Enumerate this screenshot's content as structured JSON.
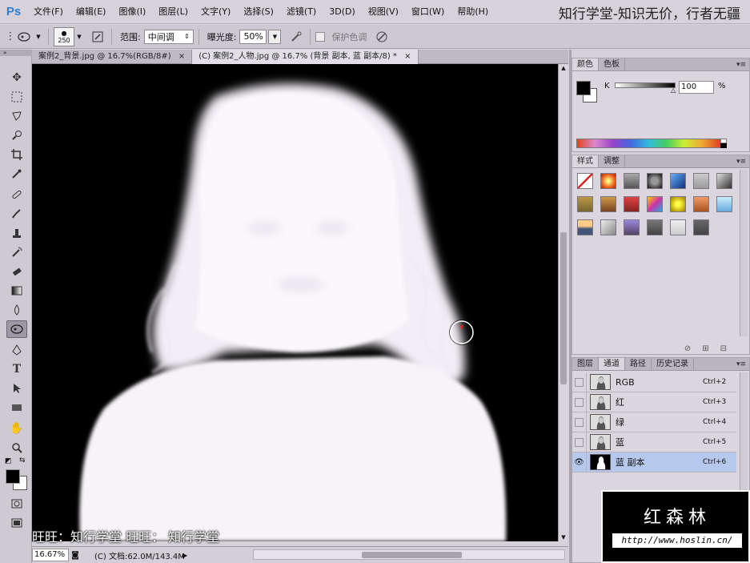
{
  "app": {
    "logo": "Ps"
  },
  "menu": [
    "文件(F)",
    "编辑(E)",
    "图像(I)",
    "图层(L)",
    "文字(Y)",
    "选择(S)",
    "滤镜(T)",
    "3D(D)",
    "视图(V)",
    "窗口(W)",
    "帮助(H)"
  ],
  "watermark_top": "知行学堂-知识无价，行者无疆",
  "options": {
    "brush_size": "250",
    "range_label": "范围:",
    "range_value": "中间调",
    "exposure_label": "曝光度:",
    "exposure_value": "50%",
    "protect_label": "保护色调"
  },
  "tabs": [
    {
      "label": "案例2_背景.jpg @ 16.7%(RGB/8#)",
      "close": "×"
    },
    {
      "label": "(C) 案例2_人物.jpg @ 16.7% (背景 副本, 蓝 副本/8) *",
      "close": "×"
    }
  ],
  "status": {
    "zoom": "16.67%",
    "doc": "(C) 文档:62.0M/143.4M"
  },
  "caption": "旺旺：知行学堂  旺旺：  知行学堂",
  "color_panel": {
    "tabs": [
      "颜色",
      "色板"
    ],
    "channel_label": "K",
    "value": "100",
    "unit": "%",
    "fg": "#000000",
    "bg": "#ffffff"
  },
  "styles_panel": {
    "tabs": [
      "样式",
      "调整"
    ]
  },
  "layers_panel": {
    "tabs": [
      "图层",
      "通道",
      "路径",
      "历史记录"
    ],
    "channels": [
      {
        "name": "RGB",
        "shortcut": "Ctrl+2",
        "visible": false
      },
      {
        "name": "红",
        "shortcut": "Ctrl+3",
        "visible": false
      },
      {
        "name": "绿",
        "shortcut": "Ctrl+4",
        "visible": false
      },
      {
        "name": "蓝",
        "shortcut": "Ctrl+5",
        "visible": false
      },
      {
        "name": "蓝 副本",
        "shortcut": "Ctrl+6",
        "visible": true
      }
    ]
  },
  "logo_box": {
    "title": "红森林",
    "url": "http://www.hoslin.cn/"
  }
}
